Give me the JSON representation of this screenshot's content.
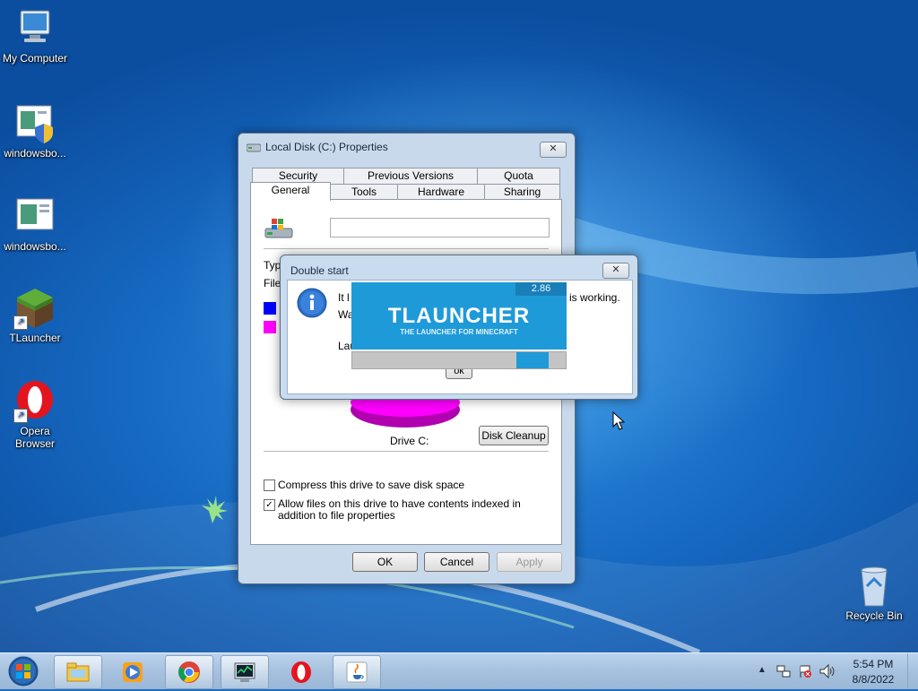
{
  "desktop": {
    "icons": [
      {
        "label": "My Computer",
        "icon": "computer-icon"
      },
      {
        "label": "windowsbo...",
        "icon": "setup-shield-icon"
      },
      {
        "label": "windowsbo...",
        "icon": "setup-icon"
      },
      {
        "label": "TLauncher",
        "icon": "tlauncher-grass-icon"
      },
      {
        "label": "Opera Browser",
        "icon": "opera-icon"
      },
      {
        "label": "Recycle Bin",
        "icon": "recycle-bin-icon"
      }
    ]
  },
  "properties": {
    "title": "Local Disk (C:) Properties",
    "tabs_back": [
      "Security",
      "Previous Versions",
      "Quota"
    ],
    "tabs_front": [
      "General",
      "Tools",
      "Hardware",
      "Sharing"
    ],
    "active_tab": "General",
    "volume_label_value": "",
    "type_label": "Typ",
    "file_label": "File",
    "drive_label": "Drive C:",
    "disk_cleanup": "Disk Cleanup",
    "compress_label": "Compress this drive to save disk space",
    "compress_checked": false,
    "index_label": "Allow files on this drive to have contents indexed in addition to file properties",
    "index_checked": true,
    "ok": "OK",
    "cancel": "Cancel",
    "apply": "Apply",
    "used_color": "#0000ff",
    "free_color": "#ff00ff"
  },
  "double_start": {
    "title": "Double start",
    "line1_start": "It l",
    "line1_end": "is working.",
    "line2_start": "Wa",
    "line3_start": "Lau",
    "ok": "ok"
  },
  "tlauncher": {
    "version": "2.86",
    "brand": "TLAUNCHER",
    "tagline": "THE LAUNCHER FOR MINECRAFT",
    "progress_fraction": 0.92
  },
  "taskbar": {
    "start": "start-orb-icon",
    "apps": [
      "explorer-icon",
      "media-player-icon",
      "chrome-icon",
      "task-manager-icon",
      "opera-icon",
      "java-icon"
    ],
    "time": "5:54 PM",
    "date": "8/8/2022"
  },
  "colors": {
    "tlauncher_blue": "#1f9ad8",
    "desktop_blue": "#1a6fc0"
  }
}
